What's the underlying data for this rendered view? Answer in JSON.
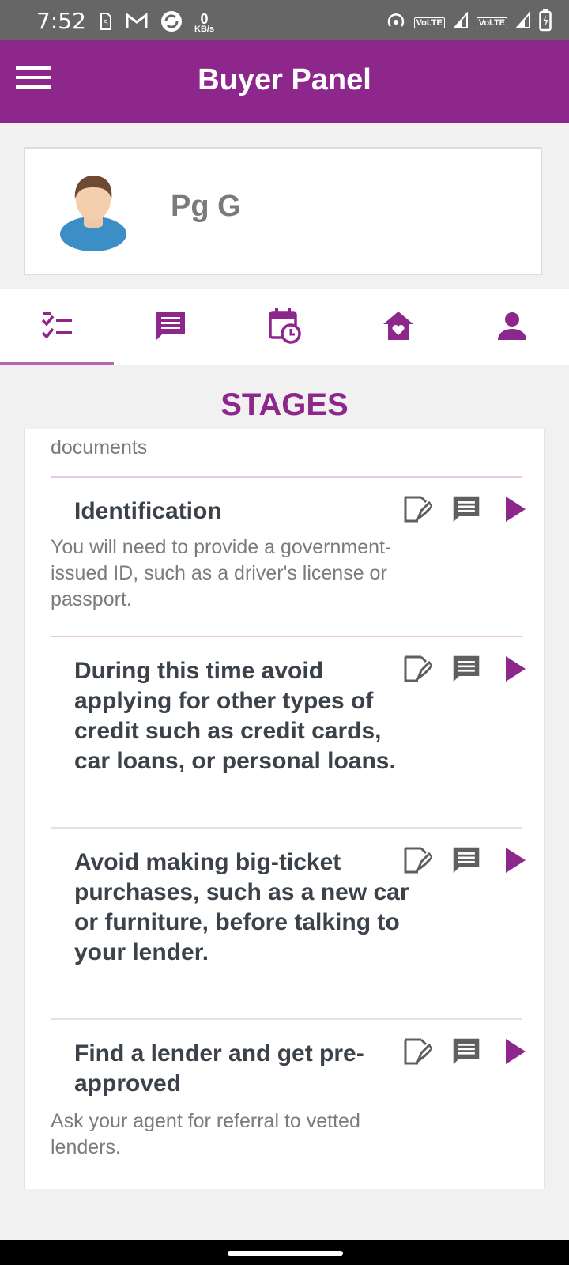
{
  "status_bar": {
    "time": "7:52",
    "net_speed_value": "0",
    "net_speed_unit": "KB/s",
    "volte_1": "VoLTE",
    "volte_2": "VoLTE"
  },
  "header": {
    "title": "Buyer Panel",
    "menu_icon": "hamburger-menu-icon",
    "background": "#8e278c"
  },
  "profile": {
    "name": "Pg G",
    "avatar_icon": "user-avatar"
  },
  "tabs": [
    {
      "icon": "checklist-icon",
      "active": true
    },
    {
      "icon": "chat-icon",
      "active": false
    },
    {
      "icon": "calendar-clock-icon",
      "active": false
    },
    {
      "icon": "home-heart-icon",
      "active": false
    },
    {
      "icon": "person-icon",
      "active": false
    }
  ],
  "section_title": "STAGES",
  "stages": {
    "partial_top_desc": "documents",
    "items": [
      {
        "title": "Identification",
        "description": "You will need to provide a government-issued ID, such as a driver's license or passport."
      },
      {
        "title": "During this time avoid applying for other types of credit such as credit cards, car loans, or personal loans.",
        "description": ""
      },
      {
        "title": "Avoid making big-ticket purchases, such as a new car or furniture, before talking to your lender.",
        "description": ""
      },
      {
        "title": "Find a lender and get pre-approved",
        "description": "Ask your agent for referral to vetted lenders."
      }
    ]
  },
  "colors": {
    "accent": "#8e278c",
    "divider_pink": "#e7c9e6",
    "divider_grey": "#e2e2e2",
    "action_grey": "#5f5f5f"
  }
}
